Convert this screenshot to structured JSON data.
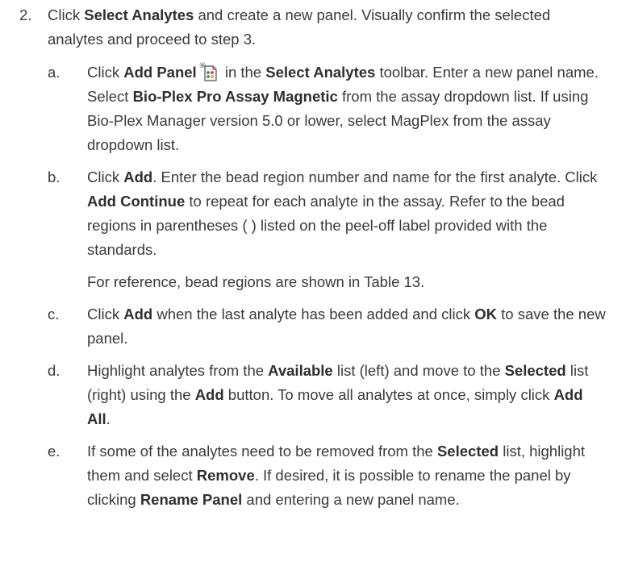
{
  "step": {
    "number": "2.",
    "intro": {
      "t1": "Click ",
      "b1": "Select Analytes",
      "t2": " and create a new panel. Visually confirm the selected analytes and proceed to step 3."
    }
  },
  "substeps": {
    "a": {
      "letter": "a.",
      "t1": "Click ",
      "b1": "Add Panel",
      "t2": " in the ",
      "b2": "Select Analytes",
      "t3": " toolbar. Enter a new panel name. Select ",
      "b3": "Bio-Plex Pro Assay Magnetic",
      "t4": " from the assay dropdown list. If using Bio-Plex Manager version 5.0 or lower, select MagPlex from the assay dropdown list.",
      "icon": "add-panel-icon"
    },
    "b": {
      "letter": "b.",
      "t1": "Click ",
      "b1": "Add",
      "t2": ". Enter the bead region number and name for the first analyte. Click ",
      "b2": "Add Continue",
      "t3": " to repeat for each analyte in the assay. Refer to the bead regions in parentheses ( ) listed on the peel-off label provided with the standards.",
      "note": "For reference, bead regions are shown in Table 13."
    },
    "c": {
      "letter": "c.",
      "t1": "Click ",
      "b1": "Add",
      "t2": " when the last analyte has been added and click ",
      "b2": "OK",
      "t3": " to save the new panel."
    },
    "d": {
      "letter": "d.",
      "t1": "Highlight analytes from the ",
      "b1": "Available",
      "t2": " list (left) and move to the ",
      "b2": "Selected",
      "t3": " list (right) using the ",
      "b3": "Add",
      "t4": " button. To move all analytes at once, simply click ",
      "b4": "Add All",
      "t5": "."
    },
    "e": {
      "letter": "e.",
      "t1": "If some of the analytes need to be removed from the ",
      "b1": "Selected",
      "t2": " list, highlight them and select ",
      "b2": "Remove",
      "t3": ". If desired, it is possible to rename the panel by clicking ",
      "b3": "Rename Panel",
      "t4": " and entering a new panel name."
    }
  },
  "colors": {
    "text": "#3a3a3a",
    "icon_doc": "#f4f4f4",
    "icon_accent": "#d23a2e"
  }
}
